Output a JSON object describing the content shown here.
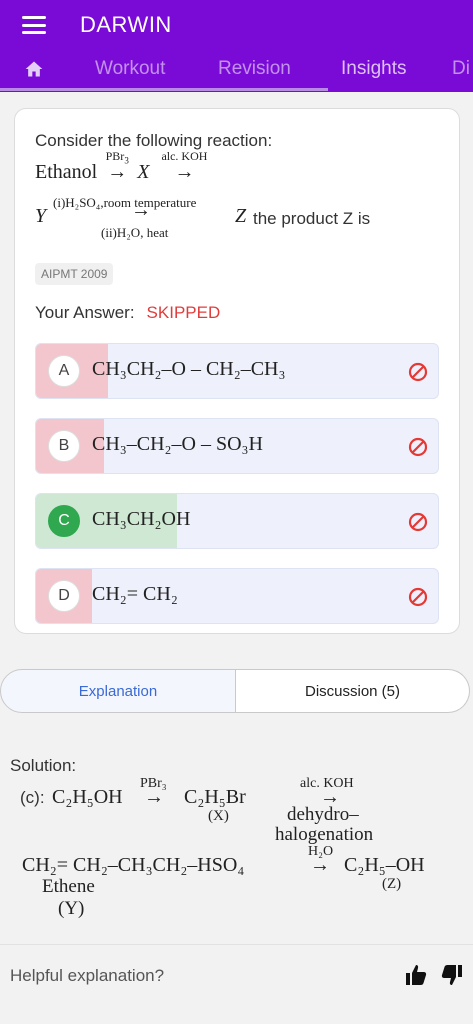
{
  "app": {
    "title": "DARWIN"
  },
  "tabs": [
    "Workout",
    "Revision",
    "Insights",
    "Di"
  ],
  "question": {
    "intro": "Consider the following reaction:",
    "reaction_start": "Ethanol",
    "arrow1_reagent": "PBr",
    "arrow1_sub": "3",
    "intermediate_x": "X",
    "arrow2_reagent": "alc. KOH",
    "y": "Y",
    "arrow3_top": "(i)H₂SO₄,room temperature",
    "arrow3_bottom": "(ii)H₂O, heat",
    "z": "Z",
    "suffix": "the product Z is",
    "tag": "AIPMT 2009"
  },
  "answer": {
    "label": "Your Answer:",
    "status": "SKIPPED"
  },
  "options": [
    {
      "letter": "A",
      "formula": "CH₃CH₂–O – CH₂–CH₃",
      "fill_fraction": 0.18,
      "fill_color": "#f3c5cd",
      "correct": false
    },
    {
      "letter": "B",
      "formula": "CH₃–CH₂–O – SO₃H",
      "fill_fraction": 0.17,
      "fill_color": "#f3c5cd",
      "correct": false
    },
    {
      "letter": "C",
      "formula": "CH₃CH₂OH",
      "fill_fraction": 0.35,
      "fill_color": "#cfe8d3",
      "correct": true
    },
    {
      "letter": "D",
      "formula": "CH₂= CH₂",
      "fill_fraction": 0.14,
      "fill_color": "#f3c5cd",
      "correct": false
    }
  ],
  "segment": {
    "explanation": "Explanation",
    "discussion": "Discussion (5)"
  },
  "solution": {
    "title": "Solution:",
    "prefix": "(c):",
    "reactant": "C₂H₅OH",
    "arrow1_top": "PBr₃",
    "product_x": "C₂H₅Br",
    "label_x": "(X)",
    "arrow2_top": "alc. KOH",
    "dehydro": "dehydro–",
    "halogenation": "halogenation",
    "line2_start": "CH₂= CH₂–CH₃CH₂–HSO₄",
    "arrow3_top": "H₂O",
    "product_z": "C₂H₅–OH",
    "label_z": "(Z)",
    "ethene": "Ethene",
    "label_y": "(Y)"
  },
  "feedback": {
    "label": "Helpful explanation?"
  },
  "colors": {
    "brand": "#7a0ad6",
    "skipped": "#e03c3c",
    "correct": "#2fa84f",
    "ban": "#e53935"
  }
}
